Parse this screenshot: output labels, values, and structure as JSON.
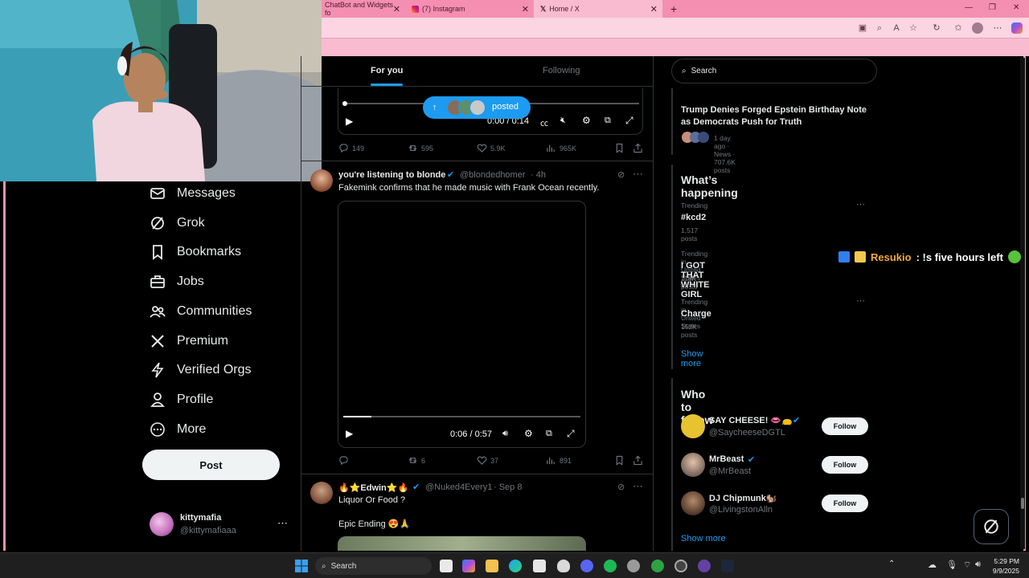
{
  "browser": {
    "tabs": [
      {
        "label": "ChatBot and Widgets fo"
      },
      {
        "label": "(7) Instagram"
      },
      {
        "label": "Home / X"
      }
    ]
  },
  "nav": {
    "items": [
      {
        "label": "Messages",
        "icon": "mail-icon"
      },
      {
        "label": "Grok",
        "icon": "grok-icon"
      },
      {
        "label": "Bookmarks",
        "icon": "bookmark-icon"
      },
      {
        "label": "Jobs",
        "icon": "briefcase-icon"
      },
      {
        "label": "Communities",
        "icon": "people-icon"
      },
      {
        "label": "Premium",
        "icon": "x-logo-icon"
      },
      {
        "label": "Verified Orgs",
        "icon": "lightning-icon"
      },
      {
        "label": "Profile",
        "icon": "person-icon"
      },
      {
        "label": "More",
        "icon": "more-circle-icon"
      }
    ],
    "post_label": "Post",
    "account": {
      "name": "kittymafia",
      "handle": "@kittymafiaaa"
    }
  },
  "feed": {
    "tabs": [
      "For you",
      "Following"
    ],
    "posted_pill": "posted",
    "post1": {
      "time": "0:00 / 0:14",
      "replies": "149",
      "reposts": "595",
      "likes": "5.9K",
      "views": "965K"
    },
    "post2": {
      "name": "you're listening to blonde",
      "handle": "@blondedhomer",
      "age": "· 4h",
      "text": "Fakemink confirms that he made music with Frank Ocean recently.",
      "time": "0:06 / 0:57",
      "reposts": "6",
      "likes": "37",
      "views": "891",
      "progress": 0.12
    },
    "post3": {
      "name": "🔥⭐Edwin⭐🔥",
      "handle": "@Nuked4Every1",
      "age": "· Sep 8",
      "text": "Liquor Or Food ?",
      "text2": "Epic Ending 😍🙏"
    }
  },
  "right": {
    "search_placeholder": "Search",
    "news": {
      "title": "Trump Denies Forged Epstein Birthday Note as Democrats Push for Truth",
      "meta": "1 day ago · News · 707.6K posts"
    },
    "happening": {
      "title": "What’s happening",
      "trends": [
        {
          "meta": "Trending",
          "name": "#kcd2",
          "posts": "1,517 posts"
        },
        {
          "meta": "Trending in United States",
          "name": "I GOT THAT WHITE GIRL",
          "posts": "118K posts"
        },
        {
          "meta": "Trending in United States",
          "name": "Charge",
          "posts": "152K posts"
        }
      ],
      "show_more": "Show more"
    },
    "who_to_follow": {
      "title": "Who to follow",
      "users": [
        {
          "name": "SAY CHEESE! 👄👝",
          "handle": "@SaycheeseDGTL",
          "button": "Follow"
        },
        {
          "name": "MrBeast",
          "handle": "@MrBeast",
          "button": "Follow"
        },
        {
          "name": "DJ Chipmunk🐿️",
          "handle": "@LivingstonAlln",
          "button": "Follow"
        }
      ],
      "show_more": "Show more"
    }
  },
  "overlay": {
    "chat_user": "Resukio",
    "chat_text": ": !s five hours left"
  },
  "taskbar": {
    "search_label": "Search",
    "time": "5:29 PM",
    "date": "9/9/2025"
  },
  "colors": {
    "accent": "#1d9bf0",
    "chrome_pink": "#f48fb1",
    "chat_name": "#f2a93b"
  }
}
